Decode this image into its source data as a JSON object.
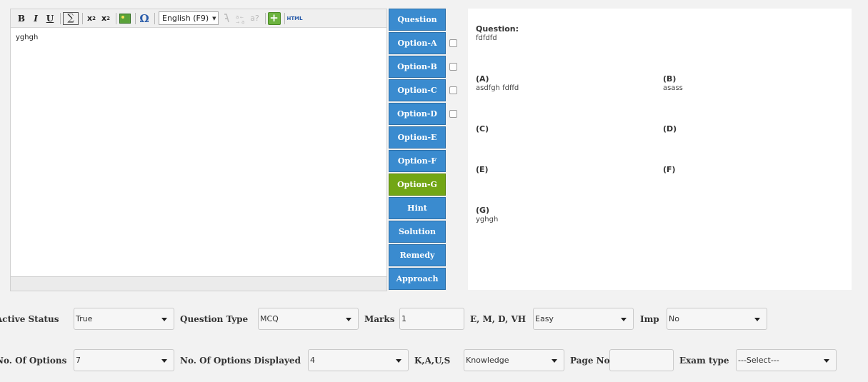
{
  "toolbar": {
    "bold": "B",
    "italic": "I",
    "underline": "U",
    "sigma": "∑",
    "subscript": "x",
    "subscript_mark": "2",
    "superscript": "x",
    "superscript_mark": "2",
    "omega": "Ω",
    "language": "English (F9)",
    "spell_a": "a?",
    "html": "HTML"
  },
  "editor": {
    "content": "yghgh"
  },
  "side_buttons": {
    "question": "Question",
    "option_a": "Option-A",
    "option_b": "Option-B",
    "option_c": "Option-C",
    "option_d": "Option-D",
    "option_e": "Option-E",
    "option_f": "Option-F",
    "option_g": "Option-G",
    "hint": "Hint",
    "solution": "Solution",
    "remedy": "Remedy",
    "approach": "Approach"
  },
  "preview": {
    "question_label": "Question:",
    "question_text": "fdfdfd",
    "a_label": "(A)",
    "a_text": "asdfgh fdffd",
    "b_label": "(B)",
    "b_text": "asass",
    "c_label": "(C)",
    "d_label": "(D)",
    "e_label": "(E)",
    "f_label": "(F)",
    "g_label": "(G)",
    "g_text": "yghgh"
  },
  "form": {
    "active_status_label": "Active Status",
    "active_status_value": "True",
    "question_type_label": "Question Type",
    "question_type_value": "MCQ",
    "marks_label": "Marks",
    "marks_value": "1",
    "emdvh_label": "E, M, D, VH",
    "emdvh_value": "Easy",
    "imp_label": "Imp",
    "imp_value": "No",
    "num_options_label": "No. Of Options",
    "num_options_value": "7",
    "num_displayed_label": "No. Of Options Displayed",
    "num_displayed_value": "4",
    "kaus_label": "K,A,U,S",
    "kaus_value": "Knowledge",
    "page_no_label": "Page No",
    "page_no_value": "",
    "exam_type_label": "Exam type",
    "exam_type_value": "---Select---"
  },
  "colors": {
    "button_blue": "#3a8bcf",
    "button_active_green": "#72a615"
  }
}
